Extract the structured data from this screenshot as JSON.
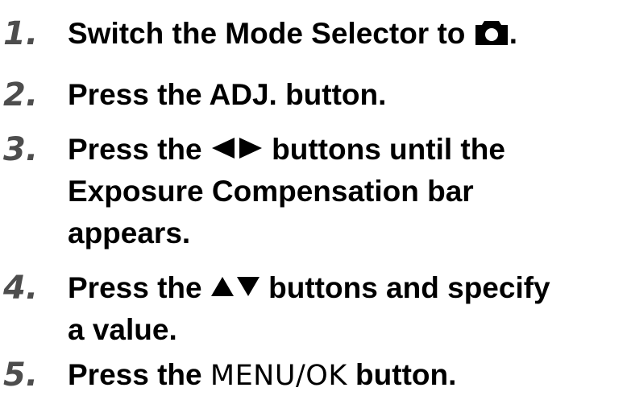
{
  "steps": [
    {
      "number": "1.",
      "before_icon": "Switch the Mode Selector to ",
      "icon": "camera-icon",
      "after_icon": "."
    },
    {
      "number": "2.",
      "text": "Press the ADJ. button."
    },
    {
      "number": "3.",
      "before_icon": "Press the ",
      "icon": "left-right-arrows-icon",
      "after_icon": " buttons until the",
      "line2": "Exposure Compensation bar",
      "line3": "appears."
    },
    {
      "number": "4.",
      "before_icon": "Press the ",
      "icon": "up-down-arrows-icon",
      "after_icon": " buttons and specify",
      "line2": "a value."
    },
    {
      "number": "5.",
      "before": "Press the ",
      "button_label": "MENU/OK",
      "after": " button."
    }
  ]
}
